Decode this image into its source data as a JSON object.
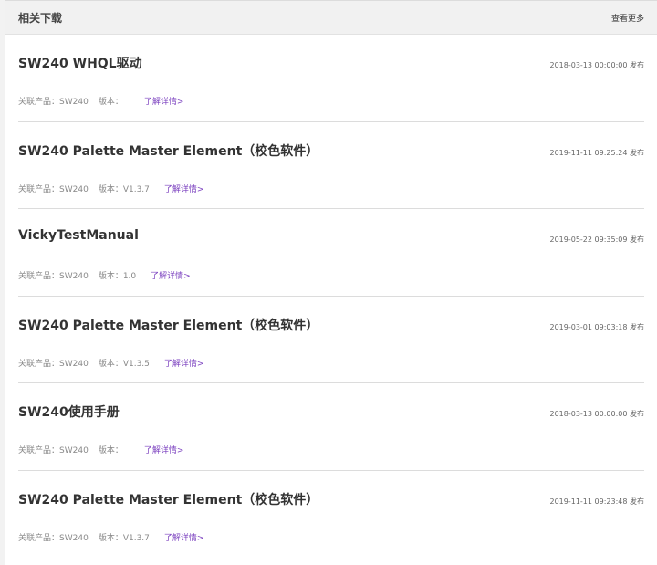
{
  "header": {
    "title": "相关下载",
    "more_label": "查看更多"
  },
  "labels": {
    "product_prefix": "关联产品：",
    "version_prefix": "版本：",
    "detail_link": "了解详情>",
    "publish_suffix": "发布"
  },
  "colors": {
    "link": "#7a3fbf",
    "header_bg": "#f1f1f1"
  },
  "downloads": [
    {
      "title": "SW240 WHQL驱动",
      "date": "2018-03-13 00:00:00",
      "product": "SW240",
      "version": ""
    },
    {
      "title": "SW240 Palette Master Element（校色软件）",
      "date": "2019-11-11 09:25:24",
      "product": "SW240",
      "version": "V1.3.7"
    },
    {
      "title": "VickyTestManual",
      "date": "2019-05-22 09:35:09",
      "product": "SW240",
      "version": "1.0"
    },
    {
      "title": "SW240 Palette Master Element（校色软件）",
      "date": "2019-03-01 09:03:18",
      "product": "SW240",
      "version": "V1.3.5"
    },
    {
      "title": "SW240使用手册",
      "date": "2018-03-13 00:00:00",
      "product": "SW240",
      "version": ""
    },
    {
      "title": "SW240 Palette Master Element（校色软件）",
      "date": "2019-11-11 09:23:48",
      "product": "SW240",
      "version": "V1.3.7"
    }
  ]
}
